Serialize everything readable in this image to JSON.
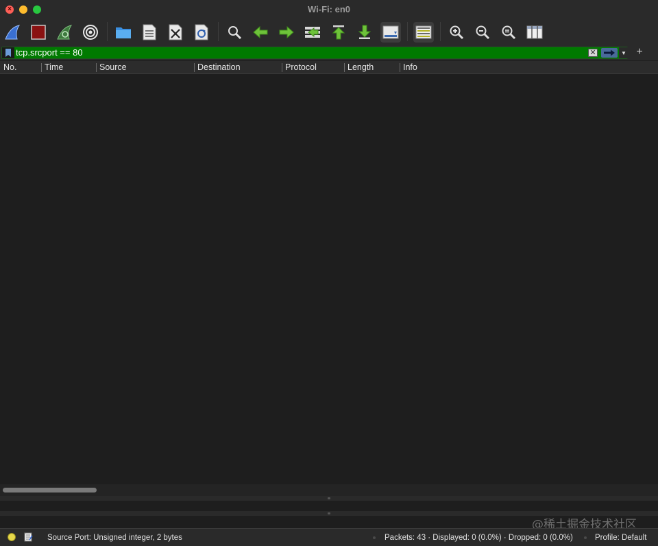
{
  "window": {
    "title": "Wi-Fi: en0",
    "traffic_lights": {
      "close": "#fe5f57",
      "minimize": "#febc2e",
      "maximize": "#28c840"
    }
  },
  "toolbar": {
    "buttons": [
      {
        "name": "start-capture",
        "icon": "shark-fin-icon"
      },
      {
        "name": "stop-capture",
        "icon": "stop-square-icon"
      },
      {
        "name": "restart-capture",
        "icon": "restart-fin-icon"
      },
      {
        "name": "capture-options",
        "icon": "gear-icon"
      },
      {
        "name": "open-file",
        "icon": "folder-icon"
      },
      {
        "name": "save-file",
        "icon": "binary-file-icon"
      },
      {
        "name": "close-file",
        "icon": "close-file-icon"
      },
      {
        "name": "reload-file",
        "icon": "reload-file-icon"
      },
      {
        "name": "find-packet",
        "icon": "magnifier-icon"
      },
      {
        "name": "go-back",
        "icon": "arrow-left-icon"
      },
      {
        "name": "go-forward",
        "icon": "arrow-right-icon"
      },
      {
        "name": "go-to-packet",
        "icon": "goto-packet-icon"
      },
      {
        "name": "go-first",
        "icon": "arrow-up-first-icon"
      },
      {
        "name": "go-last",
        "icon": "arrow-down-last-icon"
      },
      {
        "name": "auto-scroll",
        "icon": "auto-scroll-icon",
        "active": true
      },
      {
        "name": "colorize",
        "icon": "colorize-list-icon",
        "active": true
      },
      {
        "name": "zoom-in",
        "icon": "zoom-in-icon"
      },
      {
        "name": "zoom-out",
        "icon": "zoom-out-icon"
      },
      {
        "name": "normal-size",
        "icon": "zoom-normal-icon"
      },
      {
        "name": "resize-columns",
        "icon": "resize-columns-icon"
      }
    ]
  },
  "filter": {
    "value": "tcp.srcport == 80",
    "background": "#007a00",
    "add_button_label": "+"
  },
  "packet_list": {
    "columns": [
      "No.",
      "Time",
      "Source",
      "Destination",
      "Protocol",
      "Length",
      "Info"
    ],
    "rows": []
  },
  "status": {
    "field_info": "Source Port: Unsigned integer, 2 bytes",
    "packets": "Packets: 43 · Displayed: 0 (0.0%) · Dropped: 0 (0.0%)",
    "profile": "Profile: Default",
    "led_color": "#e6d84a"
  },
  "watermark": "@稀土掘金技术社区"
}
